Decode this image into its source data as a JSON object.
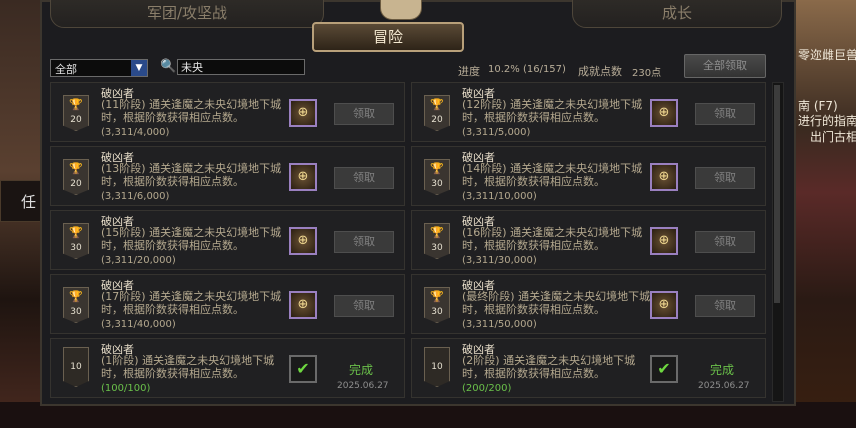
{
  "background": {
    "left_sign": "任",
    "right_texts": [
      "零迩雌巨兽",
      "南 (F7)",
      "进行的指南",
      "出门古相"
    ]
  },
  "tabs": {
    "legion": "军团/攻坚战",
    "adventure": "冒险",
    "growth": "成长"
  },
  "toolbar": {
    "filter_value": "全部",
    "search_value": "未央",
    "progress_label": "进度",
    "progress_value": "10.2% (16/157)",
    "points_label": "成就点数",
    "points_value": "230点",
    "claim_all": "全部领取"
  },
  "achievements": [
    {
      "title": "破凶者",
      "desc": "(11阶段) 通关逢魔之未央幻境地下城时，根据阶数获得相应点数。",
      "progress": "(3,311/4,000)",
      "points": "20",
      "claim": "领取"
    },
    {
      "title": "破凶者",
      "desc": "(12阶段) 通关逢魔之未央幻境地下城时，根据阶数获得相应点数。",
      "progress": "(3,311/5,000)",
      "points": "20",
      "claim": "领取"
    },
    {
      "title": "破凶者",
      "desc": "(13阶段) 通关逢魔之未央幻境地下城时，根据阶数获得相应点数。",
      "progress": "(3,311/6,000)",
      "points": "20",
      "claim": "领取"
    },
    {
      "title": "破凶者",
      "desc": "(14阶段) 通关逢魔之未央幻境地下城时，根据阶数获得相应点数。",
      "progress": "(3,311/10,000)",
      "points": "30",
      "claim": "领取"
    },
    {
      "title": "破凶者",
      "desc": "(15阶段) 通关逢魔之未央幻境地下城时，根据阶数获得相应点数。",
      "progress": "(3,311/20,000)",
      "points": "30",
      "claim": "领取"
    },
    {
      "title": "破凶者",
      "desc": "(16阶段) 通关逢魔之未央幻境地下城时，根据阶数获得相应点数。",
      "progress": "(3,311/30,000)",
      "points": "30",
      "claim": "领取"
    },
    {
      "title": "破凶者",
      "desc": "(17阶段) 通关逢魔之未央幻境地下城时，根据阶数获得相应点数。",
      "progress": "(3,311/40,000)",
      "points": "30",
      "claim": "领取"
    },
    {
      "title": "破凶者",
      "desc": "(最终阶段) 通关逢魔之未央幻境地下城时，根据阶数获得相应点数。",
      "progress": "(3,311/50,000)",
      "points": "30",
      "claim": "领取"
    },
    {
      "title": "破凶者",
      "desc": "(1阶段) 通关逢魔之未央幻境地下城时，根据阶数获得相应点数。",
      "progress": "(100/100)",
      "points": "10",
      "status": "完成",
      "date": "2025.06.27"
    },
    {
      "title": "破凶者",
      "desc": "(2阶段) 通关逢魔之未央幻境地下城时，根据阶数获得相应点数。",
      "progress": "(200/200)",
      "points": "10",
      "status": "完成",
      "date": "2025.06.27"
    }
  ],
  "icons": {
    "trophy": "trophy-icon",
    "reward": "reward-emblem-icon",
    "check": "checkmark-icon",
    "search": "search-icon",
    "dropdown": "chevron-down-icon"
  },
  "colors": {
    "panel_bg": "#1c1c1f",
    "done_green": "#6ac04a",
    "accent_gold": "#b8a07a"
  }
}
